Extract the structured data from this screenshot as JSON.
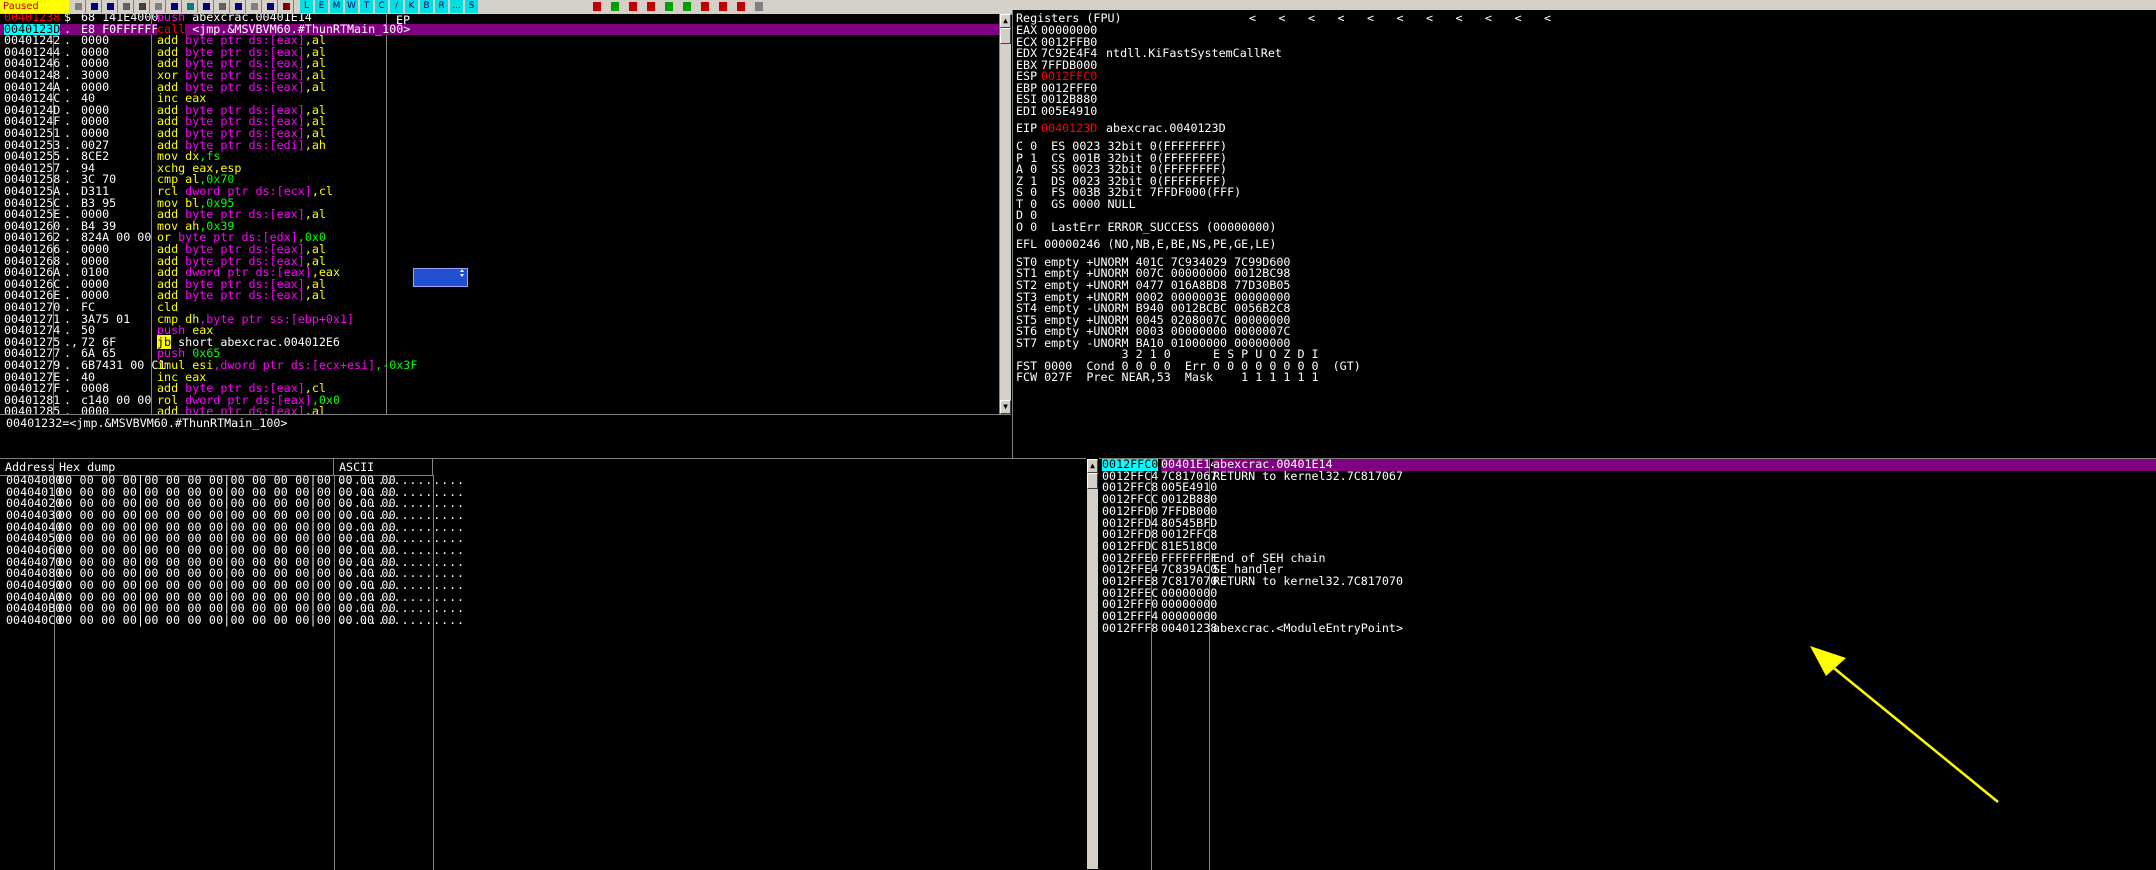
{
  "toolbar": {
    "status": "Paused",
    "letters": [
      "L",
      "E",
      "M",
      "W",
      "T",
      "C",
      "/",
      "K",
      "B",
      "R",
      "...",
      "S"
    ]
  },
  "disasm": {
    "rows": [
      {
        "addr": "00401238",
        "marker": "$",
        "hex": "68 141E4000",
        "parts": [
          [
            "push",
            "kw-push"
          ],
          [
            " abexcrac.00401E14",
            "op-white"
          ]
        ]
      },
      {
        "addr": "0040123D",
        "marker": ".",
        "hex": "E8 F0FFFFFF",
        "parts": [
          [
            "call",
            "kw-call"
          ],
          [
            " <jmp.&MSVBVM60.#ThunRTMain_100>",
            "op-white"
          ]
        ],
        "selected": true
      },
      {
        "addr": "00401242",
        "marker": ".",
        "hex": "0000",
        "parts": [
          [
            "add",
            "kw-arith"
          ],
          [
            " byte ptr ds:[eax]",
            "op-magenta"
          ],
          [
            ",al",
            "op-yellow"
          ]
        ]
      },
      {
        "addr": "00401244",
        "marker": ".",
        "hex": "0000",
        "parts": [
          [
            "add",
            "kw-arith"
          ],
          [
            " byte ptr ds:[eax]",
            "op-magenta"
          ],
          [
            ",al",
            "op-yellow"
          ]
        ]
      },
      {
        "addr": "00401246",
        "marker": ".",
        "hex": "0000",
        "parts": [
          [
            "add",
            "kw-arith"
          ],
          [
            " byte ptr ds:[eax]",
            "op-magenta"
          ],
          [
            ",al",
            "op-yellow"
          ]
        ]
      },
      {
        "addr": "00401248",
        "marker": ".",
        "hex": "3000",
        "parts": [
          [
            "xor",
            "kw-arith"
          ],
          [
            " byte ptr ds:[eax]",
            "op-magenta"
          ],
          [
            ",al",
            "op-yellow"
          ]
        ]
      },
      {
        "addr": "0040124A",
        "marker": ".",
        "hex": "0000",
        "parts": [
          [
            "add",
            "kw-arith"
          ],
          [
            " byte ptr ds:[eax]",
            "op-magenta"
          ],
          [
            ",al",
            "op-yellow"
          ]
        ]
      },
      {
        "addr": "0040124C",
        "marker": ".",
        "hex": "40",
        "parts": [
          [
            "inc",
            "kw-arith"
          ],
          [
            " eax",
            "op-yellow"
          ]
        ]
      },
      {
        "addr": "0040124D",
        "marker": ".",
        "hex": "0000",
        "parts": [
          [
            "add",
            "kw-arith"
          ],
          [
            " byte ptr ds:[eax]",
            "op-magenta"
          ],
          [
            ",al",
            "op-yellow"
          ]
        ]
      },
      {
        "addr": "0040124F",
        "marker": ".",
        "hex": "0000",
        "parts": [
          [
            "add",
            "kw-arith"
          ],
          [
            " byte ptr ds:[eax]",
            "op-magenta"
          ],
          [
            ",al",
            "op-yellow"
          ]
        ]
      },
      {
        "addr": "00401251",
        "marker": ".",
        "hex": "0000",
        "parts": [
          [
            "add",
            "kw-arith"
          ],
          [
            " byte ptr ds:[eax]",
            "op-magenta"
          ],
          [
            ",al",
            "op-yellow"
          ]
        ]
      },
      {
        "addr": "00401253",
        "marker": ".",
        "hex": "0027",
        "parts": [
          [
            "add",
            "kw-arith"
          ],
          [
            " byte ptr ds:[edi]",
            "op-magenta"
          ],
          [
            ",ah",
            "op-yellow"
          ]
        ]
      },
      {
        "addr": "00401255",
        "marker": ".",
        "hex": "8CE2",
        "parts": [
          [
            "mov",
            "kw-arith"
          ],
          [
            " dx",
            "op-yellow"
          ],
          [
            ",fs",
            "op-green"
          ]
        ]
      },
      {
        "addr": "00401257",
        "marker": ".",
        "hex": "94",
        "parts": [
          [
            "xchg",
            "kw-arith"
          ],
          [
            " eax",
            "op-yellow"
          ],
          [
            ",esp",
            "op-yellow"
          ]
        ]
      },
      {
        "addr": "00401258",
        "marker": ".",
        "hex": "3C 70",
        "parts": [
          [
            "cmp",
            "kw-arith"
          ],
          [
            " al",
            "op-yellow"
          ],
          [
            ",0x70",
            "op-imm"
          ]
        ]
      },
      {
        "addr": "0040125A",
        "marker": ".",
        "hex": "D311",
        "parts": [
          [
            "rcl",
            "kw-arith"
          ],
          [
            " dword ptr ds:[ecx]",
            "op-magenta"
          ],
          [
            ",cl",
            "op-yellow"
          ]
        ]
      },
      {
        "addr": "0040125C",
        "marker": ".",
        "hex": "B3 95",
        "parts": [
          [
            "mov",
            "kw-arith"
          ],
          [
            " bl",
            "op-yellow"
          ],
          [
            ",0x95",
            "op-imm"
          ]
        ]
      },
      {
        "addr": "0040125E",
        "marker": ".",
        "hex": "0000",
        "parts": [
          [
            "add",
            "kw-arith"
          ],
          [
            " byte ptr ds:[eax]",
            "op-magenta"
          ],
          [
            ",al",
            "op-yellow"
          ]
        ]
      },
      {
        "addr": "00401260",
        "marker": ".",
        "hex": "B4 39",
        "parts": [
          [
            "mov",
            "kw-arith"
          ],
          [
            " ah",
            "op-yellow"
          ],
          [
            ",0x39",
            "op-imm"
          ]
        ]
      },
      {
        "addr": "00401262",
        "marker": ".",
        "hex": "824A 00 00",
        "parts": [
          [
            "or",
            "kw-arith"
          ],
          [
            " byte ptr ds:[edx]",
            "op-magenta"
          ],
          [
            ",0x0",
            "op-imm"
          ]
        ]
      },
      {
        "addr": "00401266",
        "marker": ".",
        "hex": "0000",
        "parts": [
          [
            "add",
            "kw-arith"
          ],
          [
            " byte ptr ds:[eax]",
            "op-magenta"
          ],
          [
            ",al",
            "op-yellow"
          ]
        ]
      },
      {
        "addr": "00401268",
        "marker": ".",
        "hex": "0000",
        "parts": [
          [
            "add",
            "kw-arith"
          ],
          [
            " byte ptr ds:[eax]",
            "op-magenta"
          ],
          [
            ",al",
            "op-yellow"
          ]
        ]
      },
      {
        "addr": "0040126A",
        "marker": ".",
        "hex": "0100",
        "parts": [
          [
            "add",
            "kw-arith"
          ],
          [
            " dword ptr ds:[eax]",
            "op-magenta"
          ],
          [
            ",eax",
            "op-yellow"
          ]
        ]
      },
      {
        "addr": "0040126C",
        "marker": ".",
        "hex": "0000",
        "parts": [
          [
            "add",
            "kw-arith"
          ],
          [
            " byte ptr ds:[eax]",
            "op-magenta"
          ],
          [
            ",al",
            "op-yellow"
          ]
        ]
      },
      {
        "addr": "0040126E",
        "marker": ".",
        "hex": "0000",
        "parts": [
          [
            "add",
            "kw-arith"
          ],
          [
            " byte ptr ds:[eax]",
            "op-magenta"
          ],
          [
            ",al",
            "op-yellow"
          ]
        ]
      },
      {
        "addr": "00401270",
        "marker": ".",
        "hex": "FC",
        "parts": [
          [
            "cld",
            "kw-arith"
          ]
        ]
      },
      {
        "addr": "00401271",
        "marker": ".",
        "hex": "3A75 01",
        "parts": [
          [
            "cmp",
            "kw-arith"
          ],
          [
            " dh",
            "op-yellow"
          ],
          [
            ",byte ptr ss:[ebp+0x1]",
            "op-magenta"
          ]
        ]
      },
      {
        "addr": "00401274",
        "marker": ".",
        "hex": "50",
        "parts": [
          [
            "push",
            "kw-push"
          ],
          [
            " eax",
            "op-yellow"
          ]
        ]
      },
      {
        "addr": "00401275",
        "marker": ".,",
        "hex": "72 6F",
        "parts": [
          [
            "jb",
            "kw-jump"
          ],
          [
            " short abexcrac.004012E6",
            "op-white"
          ]
        ]
      },
      {
        "addr": "00401277",
        "marker": ".",
        "hex": "6A 65",
        "parts": [
          [
            "push",
            "kw-push"
          ],
          [
            " 0x65",
            "op-imm"
          ]
        ]
      },
      {
        "addr": "00401279",
        "marker": ".",
        "hex": "6B7431 00 C1",
        "parts": [
          [
            "imul",
            "kw-arith"
          ],
          [
            " esi",
            "op-yellow"
          ],
          [
            ",dword ptr ds:[ecx+esi]",
            "op-magenta"
          ],
          [
            ",-0x3F",
            "op-imm"
          ]
        ]
      },
      {
        "addr": "0040127E",
        "marker": ".",
        "hex": "40",
        "parts": [
          [
            "inc",
            "kw-arith"
          ],
          [
            " eax",
            "op-yellow"
          ]
        ]
      },
      {
        "addr": "0040127F",
        "marker": ".",
        "hex": "0008",
        "parts": [
          [
            "add",
            "kw-arith"
          ],
          [
            " byte ptr ds:[eax]",
            "op-magenta"
          ],
          [
            ",cl",
            "op-yellow"
          ]
        ]
      },
      {
        "addr": "00401281",
        "marker": ".",
        "hex": "c140 00 00",
        "parts": [
          [
            "rol",
            "kw-arith"
          ],
          [
            " dword ptr ds:[eax]",
            "op-magenta"
          ],
          [
            ",0x0",
            "op-imm"
          ]
        ]
      },
      {
        "addr": "00401285",
        "marker": ".",
        "hex": "0000",
        "parts": [
          [
            "add",
            "kw-arith"
          ],
          [
            " byte ptr ds:[eax]",
            "op-magenta"
          ],
          [
            ",al",
            "op-yellow"
          ]
        ]
      }
    ],
    "comment": "EP",
    "info_line": "00401232=<jmp.&MSVBVM60.#ThunRTMain_100>"
  },
  "registers": {
    "title": "Registers (FPU)",
    "arrows": [
      "<",
      "<",
      "<",
      "<",
      "<",
      "<",
      "<",
      "<",
      "<",
      "<",
      "<"
    ],
    "gpr": [
      {
        "name": "EAX",
        "value": "00000000",
        "comment": "",
        "red": false
      },
      {
        "name": "ECX",
        "value": "0012FFB0",
        "comment": "",
        "red": false
      },
      {
        "name": "EDX",
        "value": "7C92E4F4",
        "comment": "ntdll.KiFastSystemCallRet",
        "red": false
      },
      {
        "name": "EBX",
        "value": "7FFDB000",
        "comment": "",
        "red": false
      },
      {
        "name": "ESP",
        "value": "0012FFC0",
        "comment": "",
        "red": true
      },
      {
        "name": "EBP",
        "value": "0012FFF0",
        "comment": "",
        "red": false
      },
      {
        "name": "ESI",
        "value": "0012B880",
        "comment": "",
        "red": false
      },
      {
        "name": "EDI",
        "value": "005E4910",
        "comment": "",
        "red": false
      }
    ],
    "eip": {
      "name": "EIP",
      "value": "0040123D",
      "comment": "abexcrac.0040123D"
    },
    "flags": [
      "C 0  ES 0023 32bit 0(FFFFFFFF)",
      "P 1  CS 001B 32bit 0(FFFFFFFF)",
      "A 0  SS 0023 32bit 0(FFFFFFFF)",
      "Z 1  DS 0023 32bit 0(FFFFFFFF)",
      "S 0  FS 003B 32bit 7FFDF000(FFF)",
      "T 0  GS 0000 NULL",
      "D 0",
      "O 0  LastErr ERROR_SUCCESS (00000000)"
    ],
    "efl": "EFL 00000246 (NO,NB,E,BE,NS,PE,GE,LE)",
    "fpu": [
      "ST0 empty +UNORM 401C 7C934029 7C99D600",
      "ST1 empty +UNORM 007C 00000000 0012BC98",
      "ST2 empty +UNORM 0477 016A8BD8 77D30B05",
      "ST3 empty +UNORM 0002 0000003E 00000000",
      "ST4 empty -UNORM B940 0012BCBC 0056B2C8",
      "ST5 empty +UNORM 0045 0208007C 00000000",
      "ST6 empty +UNORM 0003 00000000 0000007C",
      "ST7 empty -UNORM BA10 01000000 00000000"
    ],
    "fpu_bits_header": "               3 2 1 0      E S P U O Z D I",
    "fst": "FST 0000  Cond 0 0 0 0  Err 0 0 0 0 0 0 0 0  (GT)",
    "fcw": "FCW 027F  Prec NEAR,53  Mask    1 1 1 1 1 1"
  },
  "dump": {
    "headers": [
      "Address",
      "Hex dump",
      "ASCII"
    ],
    "rows": [
      {
        "addr": "00404000",
        "hex": "00 00 00 00|00 00 00 00|00 00 00 00|00 00 00 00",
        "ascii": "................"
      },
      {
        "addr": "00404010",
        "hex": "00 00 00 00|00 00 00 00|00 00 00 00|00 00 00 00",
        "ascii": "................"
      },
      {
        "addr": "00404020",
        "hex": "00 00 00 00|00 00 00 00|00 00 00 00|00 00 00 00",
        "ascii": "................"
      },
      {
        "addr": "00404030",
        "hex": "00 00 00 00|00 00 00 00|00 00 00 00|00 00 00 00",
        "ascii": "................"
      },
      {
        "addr": "00404040",
        "hex": "00 00 00 00|00 00 00 00|00 00 00 00|00 00 00 00",
        "ascii": "................"
      },
      {
        "addr": "00404050",
        "hex": "00 00 00 00|00 00 00 00|00 00 00 00|00 00 00 00",
        "ascii": "................"
      },
      {
        "addr": "00404060",
        "hex": "00 00 00 00|00 00 00 00|00 00 00 00|00 00 00 00",
        "ascii": "................"
      },
      {
        "addr": "00404070",
        "hex": "00 00 00 00|00 00 00 00|00 00 00 00|00 00 00 00",
        "ascii": "................"
      },
      {
        "addr": "00404080",
        "hex": "00 00 00 00|00 00 00 00|00 00 00 00|00 00 00 00",
        "ascii": "................"
      },
      {
        "addr": "00404090",
        "hex": "00 00 00 00|00 00 00 00|00 00 00 00|00 00 00 00",
        "ascii": "................"
      },
      {
        "addr": "004040A0",
        "hex": "00 00 00 00|00 00 00 00|00 00 00 00|00 00 00 00",
        "ascii": "................"
      },
      {
        "addr": "004040B0",
        "hex": "00 00 00 00|00 00 00 00|00 00 00 00|00 00 00 00",
        "ascii": "................"
      },
      {
        "addr": "004040C0",
        "hex": "00 00 00 00|00 00 00 00|00 00 00 00|00 00 00 00",
        "ascii": "................"
      }
    ]
  },
  "stack": {
    "rows": [
      {
        "addr": "0012FFC0",
        "value": "00401E14",
        "comment": "abexcrac.00401E14",
        "selected": true
      },
      {
        "addr": "0012FFC4",
        "value": "7C817067",
        "comment": "RETURN to kernel32.7C817067"
      },
      {
        "addr": "0012FFC8",
        "value": "005E4910",
        "comment": ""
      },
      {
        "addr": "0012FFCC",
        "value": "0012B880",
        "comment": ""
      },
      {
        "addr": "0012FFD0",
        "value": "7FFDB000",
        "comment": ""
      },
      {
        "addr": "0012FFD4",
        "value": "80545BFD",
        "comment": ""
      },
      {
        "addr": "0012FFD8",
        "value": "0012FFC8",
        "comment": ""
      },
      {
        "addr": "0012FFDC",
        "value": "81E518C0",
        "comment": ""
      },
      {
        "addr": "0012FFE0",
        "value": "FFFFFFFF",
        "comment": "End of SEH chain"
      },
      {
        "addr": "0012FFE4",
        "value": "7C839AC0",
        "comment": "SE handler"
      },
      {
        "addr": "0012FFE8",
        "value": "7C817070",
        "comment": "RETURN to kernel32.7C817070"
      },
      {
        "addr": "0012FFEC",
        "value": "00000000",
        "comment": ""
      },
      {
        "addr": "0012FFF0",
        "value": "00000000",
        "comment": ""
      },
      {
        "addr": "0012FFF4",
        "value": "00000000",
        "comment": ""
      },
      {
        "addr": "0012FFF8",
        "value": "00401238",
        "comment": "abexcrac.<ModuleEntryPoint>"
      }
    ]
  },
  "colors": {
    "selection": "#800080",
    "accent_yellow": "#ffff00",
    "red": "#ff0000"
  }
}
